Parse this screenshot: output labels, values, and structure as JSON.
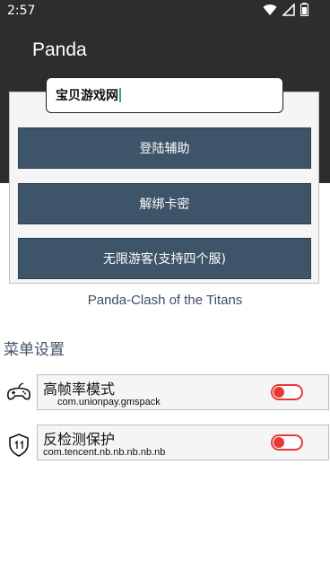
{
  "status_bar": {
    "time": "2:57",
    "icons": [
      "wifi-icon",
      "signal-icon",
      "battery-icon"
    ]
  },
  "app": {
    "title": "Panda"
  },
  "input": {
    "value": "宝贝游戏网"
  },
  "buttons": [
    {
      "label": "登陆辅助"
    },
    {
      "label": "解绑卡密"
    },
    {
      "label": "无限游客(支持四个服)"
    }
  ],
  "subtitle": "Panda-Clash of the Titans",
  "menu": {
    "title": "菜单设置",
    "items": [
      {
        "title": "高帧率模式",
        "subtitle": "com.unionpay.gmspack",
        "icon": "gamepad-icon",
        "enabled": false
      },
      {
        "title": "反检测保护",
        "subtitle": "com.tencent.nb.nb.nb.nb.nb",
        "icon": "shield-icon",
        "enabled": false
      }
    ]
  },
  "colors": {
    "header": "#2d2d2d",
    "button": "#3d5469",
    "toggle_off": "#e53935",
    "cursor": "#26a69a"
  }
}
